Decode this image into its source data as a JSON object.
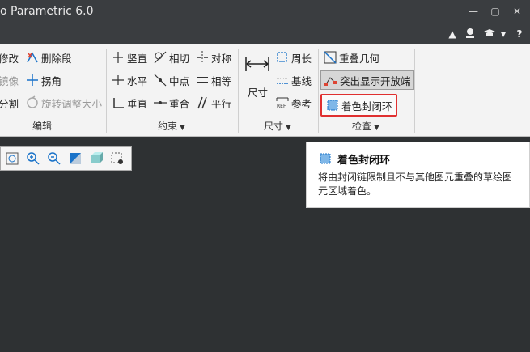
{
  "window": {
    "title": "o Parametric 6.0",
    "minimize_glyph": "—",
    "restore_glyph": "▢",
    "close_glyph": "✕"
  },
  "toolbar2": {
    "up_glyph": "▲",
    "caret_glyph": "▾",
    "help_glyph": "?"
  },
  "ribbon": {
    "edit": {
      "modify": "修改",
      "delete_segment": "删除段",
      "mirror": "镜像",
      "corner": "拐角",
      "divide": "分割",
      "rotate_resize": "旋转调整大小",
      "label": "编辑"
    },
    "constrain": {
      "vertical": "竖直",
      "tangent": "相切",
      "symmetric": "对称",
      "horizontal": "水平",
      "midpoint": "中点",
      "equal": "相等",
      "perpendicular": "垂直",
      "coincident": "重合",
      "parallel": "平行",
      "label": "约束"
    },
    "dimension": {
      "normal": "尺寸",
      "perimeter": "周长",
      "baseline": "基线",
      "reference": "参考",
      "label": "尺寸"
    },
    "inspect": {
      "overlap": "重叠几何",
      "highlight_open": "突出显示开放端",
      "shade_closed": "着色封闭环",
      "label": "检查"
    }
  },
  "tooltip": {
    "title": "着色封闭环",
    "description": "将由封闭链限制且不与其他图元重叠的草绘图元区域着色。"
  },
  "colors": {
    "accent": "#1a73c9",
    "highlight_border": "#e03030",
    "canvas": "#2e3133"
  }
}
